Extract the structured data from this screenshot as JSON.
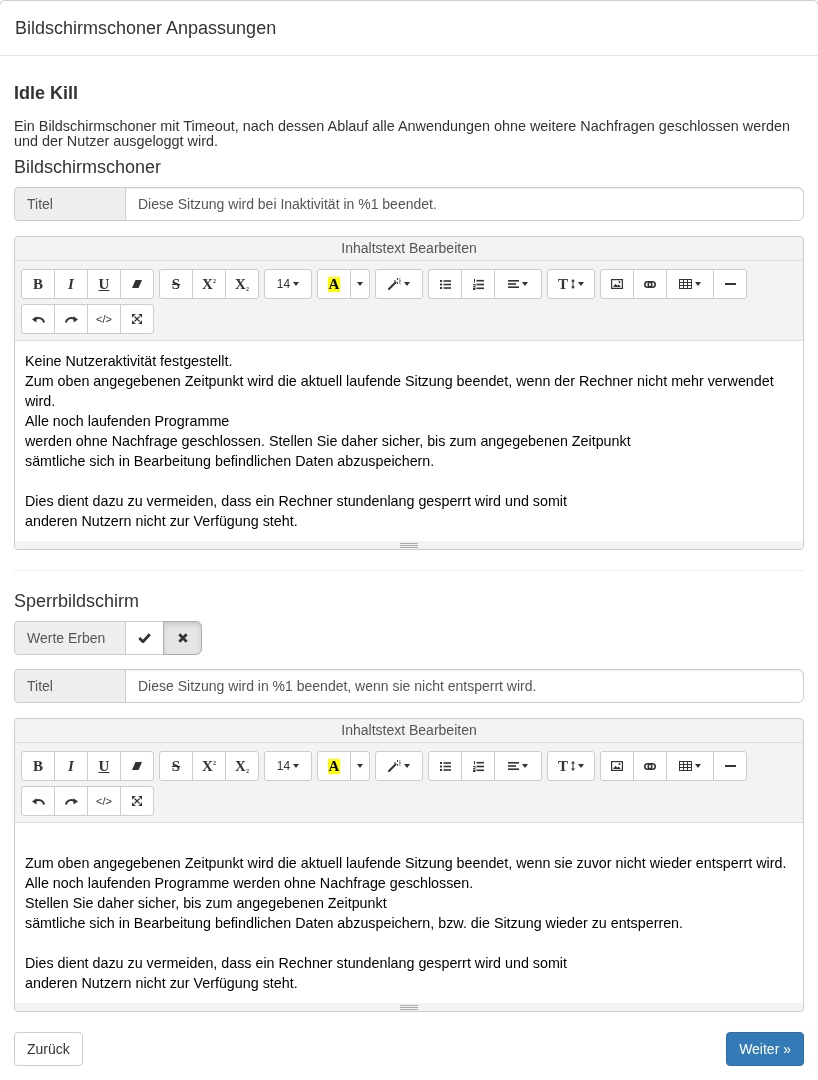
{
  "dialog": {
    "title": "Bildschirmschoner Anpassungen"
  },
  "intro": {
    "heading": "Idle Kill",
    "description": "Ein Bildschirmschoner mit Timeout, nach dessen Ablauf alle Anwendungen ohne weitere Nachfragen geschlossen werden und der Nutzer ausgeloggt wird."
  },
  "sections": [
    {
      "heading": "Bildschirmschoner",
      "title_field": {
        "label": "Titel",
        "value": "Diese Sitzung wird bei Inaktivität in %1 beendet."
      },
      "editor": {
        "header": "Inhaltstext Bearbeiten",
        "toolbar": [
          [
            {
              "kind": "bold",
              "label": "B"
            },
            {
              "kind": "italic",
              "label": "I"
            },
            {
              "kind": "underline",
              "label": "U"
            },
            {
              "kind": "eraser"
            }
          ],
          [
            {
              "kind": "strikethrough",
              "label": "S"
            },
            {
              "kind": "superscript",
              "label": "X$^{2}$"
            },
            {
              "kind": "subscript",
              "label": "X$_{2}$"
            }
          ],
          [
            {
              "kind": "font-size",
              "label": "14"
            }
          ],
          [
            {
              "kind": "color",
              "label": "A"
            },
            {
              "kind": "color-menu"
            }
          ],
          [
            {
              "kind": "style"
            }
          ],
          [
            {
              "kind": "bullet-list"
            },
            {
              "kind": "numbered-list"
            },
            {
              "kind": "align"
            }
          ],
          [
            {
              "kind": "line-height",
              "label": "T"
            }
          ],
          [
            {
              "kind": "picture"
            },
            {
              "kind": "link"
            },
            {
              "kind": "table"
            },
            {
              "kind": "rule"
            }
          ],
          [
            {
              "kind": "undo"
            },
            {
              "kind": "redo"
            },
            {
              "kind": "code-view",
              "label": "</>"
            },
            {
              "kind": "fullscreen"
            }
          ]
        ],
        "leading_blank_line": false,
        "paragraphs": [
          [
            "Keine Nutzeraktivität festgestellt.",
            "Zum oben angegebenen Zeitpunkt wird die aktuell laufende Sitzung beendet, wenn der Rechner nicht mehr verwendet wird.",
            "Alle noch laufenden Programme",
            "werden ohne Nachfrage geschlossen. Stellen Sie daher sicher, bis zum angegebenen Zeitpunkt",
            "sämtliche sich in Bearbeitung befindlichen Daten abzuspeichern."
          ],
          [
            "Dies dient dazu zu vermeiden, dass ein Rechner stundenlang gesperrt wird und somit",
            "anderen Nutzern nicht zur Verfügung steht."
          ]
        ]
      }
    },
    {
      "heading": "Sperrbildschirm",
      "inherit": {
        "label": "Werte Erben",
        "options": [
          {
            "kind": "yes",
            "selected": false
          },
          {
            "kind": "no",
            "selected": true
          }
        ]
      },
      "title_field": {
        "label": "Titel",
        "value": "Diese Sitzung wird in %1 beendet, wenn sie nicht entsperrt wird."
      },
      "editor": {
        "header": "Inhaltstext Bearbeiten",
        "toolbar": [
          [
            {
              "kind": "bold",
              "label": "B"
            },
            {
              "kind": "italic",
              "label": "I"
            },
            {
              "kind": "underline",
              "label": "U"
            },
            {
              "kind": "eraser"
            }
          ],
          [
            {
              "kind": "strikethrough",
              "label": "S"
            },
            {
              "kind": "superscript",
              "label": "X$^{2}$"
            },
            {
              "kind": "subscript",
              "label": "X$_{2}$"
            }
          ],
          [
            {
              "kind": "font-size",
              "label": "14"
            }
          ],
          [
            {
              "kind": "color",
              "label": "A"
            },
            {
              "kind": "color-menu"
            }
          ],
          [
            {
              "kind": "style"
            }
          ],
          [
            {
              "kind": "bullet-list"
            },
            {
              "kind": "numbered-list"
            },
            {
              "kind": "align"
            }
          ],
          [
            {
              "kind": "line-height",
              "label": "T"
            }
          ],
          [
            {
              "kind": "picture"
            },
            {
              "kind": "link"
            },
            {
              "kind": "table"
            },
            {
              "kind": "rule"
            }
          ],
          [
            {
              "kind": "undo"
            },
            {
              "kind": "redo"
            },
            {
              "kind": "code-view",
              "label": "</>"
            },
            {
              "kind": "fullscreen"
            }
          ]
        ],
        "leading_blank_line": true,
        "paragraphs": [
          [
            "Zum oben angegebenen Zeitpunkt wird die aktuell laufende Sitzung beendet, wenn sie zuvor nicht wieder entsperrt wird.",
            "Alle noch laufenden Programme werden ohne Nachfrage geschlossen.",
            "Stellen Sie daher sicher, bis zum angegebenen Zeitpunkt",
            "sämtliche sich in Bearbeitung befindlichen Daten abzuspeichern, bzw. die Sitzung wieder zu entsperren."
          ],
          [
            "Dies dient dazu zu vermeiden, dass ein Rechner stundenlang gesperrt wird und somit",
            "anderen Nutzern nicht zur Verfügung steht."
          ]
        ]
      }
    }
  ],
  "buttons": [
    {
      "kind": "back",
      "label": "Zurück"
    },
    {
      "kind": "next",
      "label": "Weiter »"
    }
  ]
}
